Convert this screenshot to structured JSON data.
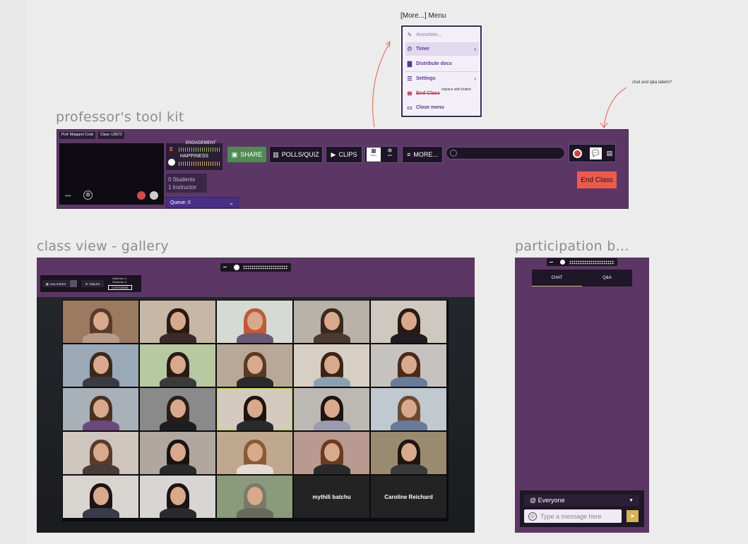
{
  "more_menu": {
    "caption": "[More...] Menu",
    "items": [
      {
        "icon": "pencil-icon",
        "label": "Annotate..."
      },
      {
        "icon": "timer-icon",
        "label": "Timer",
        "chevron": "›"
      },
      {
        "icon": "document-icon",
        "label": "Distribute docs"
      },
      {
        "icon": "sliders-icon",
        "label": "Settings",
        "chevron": "›"
      },
      {
        "icon": "end-class-icon",
        "label": "End Class"
      },
      {
        "icon": "monitor-icon",
        "label": "Close menu"
      }
    ],
    "note": "replace with button"
  },
  "annotation": "chat and q&a labels?",
  "toolkit": {
    "section_title": "professor's tool kit",
    "prof_label": "Prof: Margaret Cook",
    "class_label": "Class: US673",
    "engagement_label": "ENGAGEMENT",
    "happiness_label": "HAPPINESS",
    "students": "0 Students",
    "instructors": "1 Instructor",
    "queue": "Queue: 0",
    "share": "SHARE",
    "polls": "POLLS/QUIZ",
    "clips": "CLIPS",
    "more": "MORE...",
    "end_class": "End Class",
    "view_label_1": "gallery",
    "view_label_2": "table"
  },
  "gallery": {
    "section_title": "class view - gallery",
    "gallery_btn": "GALLERIES",
    "tables_btn": "TABLES",
    "galleries_count": "Galleries: 0",
    "students_count": "Students: 0",
    "customize": "CUSTOMIZE",
    "tiles": [
      {
        "name": ""
      },
      {
        "name": ""
      },
      {
        "name": ""
      },
      {
        "name": ""
      },
      {
        "name": ""
      },
      {
        "name": ""
      },
      {
        "name": ""
      },
      {
        "name": ""
      },
      {
        "name": ""
      },
      {
        "name": ""
      },
      {
        "name": ""
      },
      {
        "name": ""
      },
      {
        "name": ""
      },
      {
        "name": ""
      },
      {
        "name": ""
      },
      {
        "name": ""
      },
      {
        "name": ""
      },
      {
        "name": ""
      },
      {
        "name": ""
      },
      {
        "name": ""
      },
      {
        "name": ""
      },
      {
        "name": ""
      },
      {
        "name": ""
      },
      {
        "name": "mythili batchu"
      },
      {
        "name": "Caroline Reichard"
      }
    ]
  },
  "participation": {
    "section_title": "participation b...",
    "tab_chat": "CHAT",
    "tab_qa": "Q&A",
    "recipient": "@ Everyone",
    "placeholder": "Type a message here"
  }
}
